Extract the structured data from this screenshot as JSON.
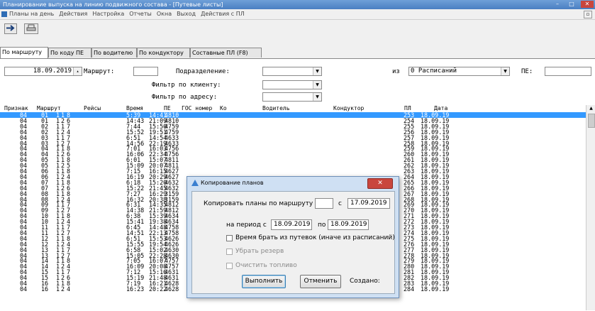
{
  "window": {
    "title": "Планирование выпуска на линию подвижного состава - [Путевые листы]",
    "controls": [
      "–",
      "□",
      "✕"
    ]
  },
  "menu": {
    "items": [
      "Планы на день",
      "Действия",
      "Настройка",
      "Отчеты",
      "Окна",
      "Выход",
      "Действия с ПЛ"
    ],
    "mdi_restore": "▫"
  },
  "toolbar": {
    "btn1_icon": "arrow-right-icon",
    "btn2_icon": "print-icon"
  },
  "tabs": [
    "По маршруту",
    "По коду ПЕ",
    "По водителю",
    "По кондуктору",
    "Составные ПЛ (F8)"
  ],
  "filters": {
    "date": "18.09.2019",
    "route_label": "Маршрут:",
    "route_value": "",
    "division_label": "Подразделение:",
    "division_value": "",
    "of_label": "из",
    "schedule_value": "0 Расписаний",
    "pe_label": "ПЕ:",
    "pe_value": "",
    "client_label": "Фильтр по клиенту:",
    "client_value": "",
    "address_label": "Фильтр по адресу:",
    "address_value": ""
  },
  "grid": {
    "headers": {
      "priznak": "Признак",
      "route": "Маршрут",
      "trips": "Рейсы",
      "time": "Время",
      "pe": "ПЕ",
      "gos": "ГОС номер",
      "ko": "Ко",
      "driver": "Водитель",
      "conductor": "Кондуктор",
      "pl": "ПЛ",
      "date": "Дата"
    },
    "rows": [
      [
        "04",
        "01",
        "1",
        "1",
        "8",
        "5:39",
        "14:41",
        "4810",
        "253",
        "18.09.19"
      ],
      [
        "04",
        "01",
        "1",
        "2",
        "6",
        "14:43",
        "21:09",
        "4810",
        "254",
        "18.09.19"
      ],
      [
        "04",
        "02",
        "1",
        "1",
        "7",
        "7:44",
        "15:50",
        "4759",
        "255",
        "18.09.19"
      ],
      [
        "04",
        "02",
        "1",
        "2",
        "4",
        "15:52",
        "19:51",
        "4759",
        "256",
        "18.09.19"
      ],
      [
        "04",
        "03",
        "1",
        "1",
        "7",
        "6:51",
        "14:54",
        "4633",
        "257",
        "18.09.19"
      ],
      [
        "04",
        "03",
        "1",
        "2",
        "7",
        "14:56",
        "22:19",
        "4633",
        "258",
        "18.09.19"
      ],
      [
        "04",
        "04",
        "1",
        "1",
        "8",
        "7:01",
        "16:03",
        "4756",
        "259",
        "18.09.19"
      ],
      [
        "04",
        "04",
        "1",
        "2",
        "6",
        "16:06",
        "22:34",
        "4756",
        "260",
        "18.09.19"
      ],
      [
        "04",
        "05",
        "1",
        "1",
        "8",
        "6:01",
        "15:07",
        "4811",
        "261",
        "18.09.19"
      ],
      [
        "04",
        "05",
        "1",
        "2",
        "5",
        "15:09",
        "20:07",
        "4811",
        "262",
        "18.09.19"
      ],
      [
        "04",
        "06",
        "1",
        "1",
        "8",
        "7:15",
        "16:15",
        "4627",
        "263",
        "18.09.19"
      ],
      [
        "04",
        "06",
        "1",
        "2",
        "4",
        "16:19",
        "20:29",
        "4627",
        "264",
        "18.09.19"
      ],
      [
        "04",
        "07",
        "1",
        "1",
        "8",
        "6:18",
        "15:20",
        "4632",
        "265",
        "18.09.19"
      ],
      [
        "04",
        "07",
        "1",
        "2",
        "6",
        "15:22",
        "21:45",
        "4632",
        "266",
        "18.09.19"
      ],
      [
        "04",
        "08",
        "1",
        "1",
        "8",
        "7:27",
        "16:29",
        "3159",
        "267",
        "18.09.19"
      ],
      [
        "04",
        "08",
        "1",
        "2",
        "4",
        "16:32",
        "20:38",
        "3159",
        "268",
        "18.09.19"
      ],
      [
        "04",
        "09",
        "1",
        "1",
        "7",
        "6:31",
        "14:35",
        "4812",
        "269",
        "18.09.19"
      ],
      [
        "04",
        "09",
        "1",
        "2",
        "7",
        "14:38",
        "21:59",
        "4812",
        "270",
        "18.09.19"
      ],
      [
        "04",
        "10",
        "1",
        "1",
        "8",
        "6:38",
        "15:39",
        "4634",
        "271",
        "18.09.19"
      ],
      [
        "04",
        "10",
        "1",
        "2",
        "4",
        "15:41",
        "19:38",
        "4634",
        "272",
        "18.09.19"
      ],
      [
        "04",
        "11",
        "1",
        "1",
        "7",
        "6:45",
        "14:48",
        "4758",
        "273",
        "18.09.19"
      ],
      [
        "04",
        "11",
        "1",
        "2",
        "7",
        "14:51",
        "22:13",
        "4758",
        "274",
        "18.09.19"
      ],
      [
        "04",
        "12",
        "1",
        "1",
        "8",
        "6:51",
        "15:53",
        "4626",
        "275",
        "18.09.19"
      ],
      [
        "04",
        "12",
        "1",
        "2",
        "4",
        "15:55",
        "19:54",
        "4626",
        "276",
        "18.09.19"
      ],
      [
        "04",
        "13",
        "1",
        "1",
        "7",
        "6:58",
        "15:02",
        "4630",
        "277",
        "18.09.19"
      ],
      [
        "04",
        "13",
        "1",
        "2",
        "7",
        "15:05",
        "22:28",
        "4630",
        "278",
        "18.09.19"
      ],
      [
        "04",
        "14",
        "1",
        "1",
        "8",
        "7:05",
        "16:07",
        "4757",
        "279",
        "18.09.19"
      ],
      [
        "04",
        "14",
        "1",
        "2",
        "4",
        "16:09",
        "20:08",
        "4757",
        "280",
        "18.09.19"
      ],
      [
        "04",
        "15",
        "1",
        "1",
        "7",
        "7:12",
        "15:16",
        "4631",
        "281",
        "18.09.19"
      ],
      [
        "04",
        "15",
        "1",
        "2",
        "6",
        "15:19",
        "21:48",
        "4631",
        "282",
        "18.09.19"
      ],
      [
        "04",
        "16",
        "1",
        "1",
        "8",
        "7:19",
        "16:21",
        "4628",
        "283",
        "18.09.19"
      ],
      [
        "04",
        "16",
        "1",
        "2",
        "4",
        "16:23",
        "20:22",
        "4628",
        "284",
        "18.09.19"
      ]
    ]
  },
  "dialog": {
    "title": "Копирование планов",
    "close": "✕",
    "copy_label": "Копировать планы по маршруту",
    "route_value": "",
    "with_label": "с",
    "with_date": "17.09.2019",
    "period_label": "на период с",
    "period_from": "18.09.2019",
    "period_to_label": "по",
    "period_to": "18.09.2019",
    "opt_time": "Время брать из путевок (иначе из расписаний)",
    "opt_reserve": "Убрать резерв",
    "opt_fuel": "Очистить топливо",
    "run_button": "Выполнить",
    "cancel_button": "Отменить",
    "created_label": "Создано:"
  }
}
